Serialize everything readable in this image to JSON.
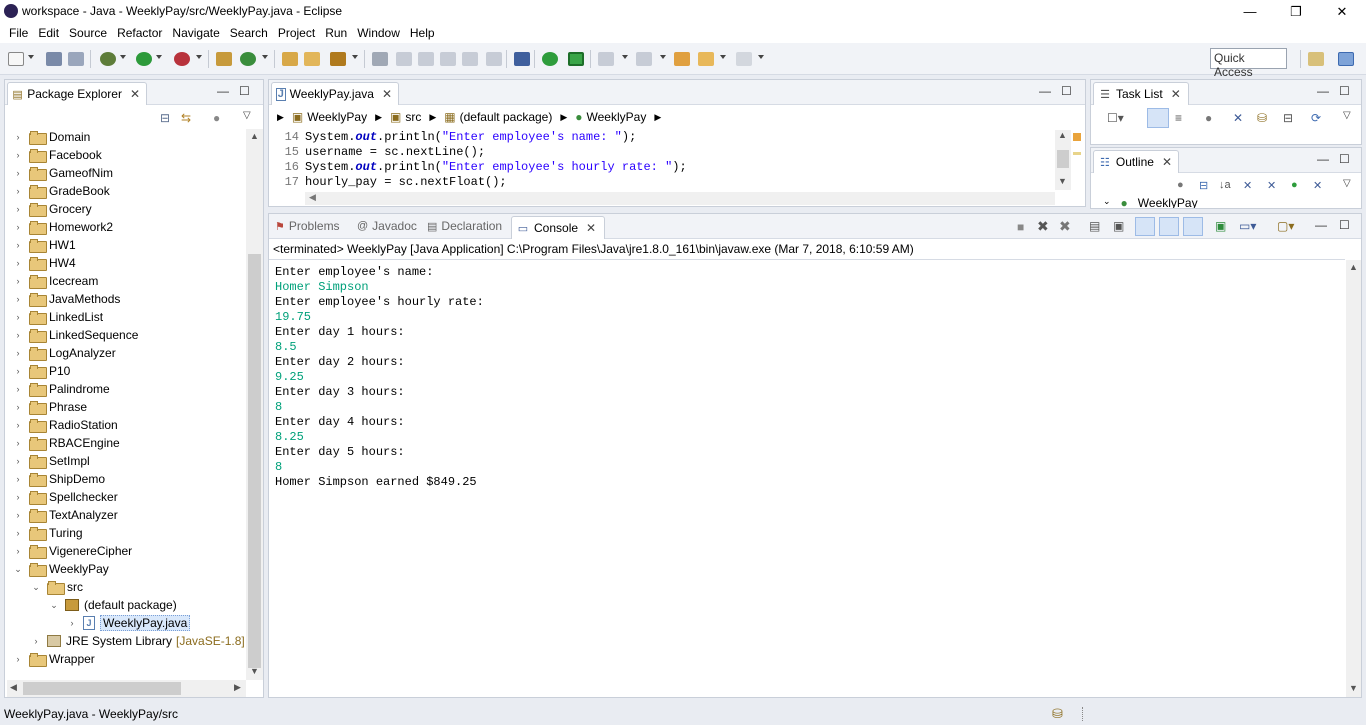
{
  "window": {
    "title": "workspace - Java - WeeklyPay/src/WeeklyPay.java - Eclipse",
    "minimize": "—",
    "restore": "❐",
    "close": "✕"
  },
  "menu": [
    "File",
    "Edit",
    "Source",
    "Refactor",
    "Navigate",
    "Search",
    "Project",
    "Run",
    "Window",
    "Help"
  ],
  "toolbar": {
    "quick_access": "Quick Access"
  },
  "package_explorer": {
    "tab_label": "Package Explorer",
    "projects": [
      "Domain",
      "Facebook",
      "GameofNim",
      "GradeBook",
      "Grocery",
      "Homework2",
      "HW1",
      "HW4",
      "Icecream",
      "JavaMethods",
      "LinkedList",
      "LinkedSequence",
      "LogAnalyzer",
      "P10",
      "Palindrome",
      "Phrase",
      "RadioStation",
      "RBACEngine",
      "SetImpl",
      "ShipDemo",
      "Spellchecker",
      "TextAnalyzer",
      "Turing",
      "VigenereCipher",
      "WeeklyPay"
    ],
    "expanded": {
      "src": "src",
      "default_package": "(default package)",
      "file": "WeeklyPay.java",
      "jre": "JRE System Library",
      "jre_version": "[JavaSE-1.8]",
      "last_project": "Wrapper"
    }
  },
  "editor": {
    "tab_label": "WeeklyPay.java",
    "breadcrumb": [
      "WeeklyPay",
      "src",
      "(default package)",
      "WeeklyPay"
    ],
    "lines": [
      {
        "num": "14",
        "pre": "System.",
        "field": "out",
        "mid": ".println(",
        "str": "\"Enter employee's name: \"",
        "post": ");"
      },
      {
        "num": "15",
        "pre": "username = sc.nextLine();",
        "field": "",
        "mid": "",
        "str": "",
        "post": ""
      },
      {
        "num": "16",
        "pre": "System.",
        "field": "out",
        "mid": ".println(",
        "str": "\"Enter employee's hourly rate: \"",
        "post": ");"
      },
      {
        "num": "17",
        "pre": "hourly_pay = sc.nextFloat();",
        "field": "",
        "mid": "",
        "str": "",
        "post": ""
      }
    ]
  },
  "task_list": {
    "tab_label": "Task List"
  },
  "outline": {
    "tab_label": "Outline",
    "item": "WeeklyPay"
  },
  "console_view": {
    "tabs": {
      "problems": "Problems",
      "javadoc": "Javadoc",
      "declaration": "Declaration",
      "console": "Console"
    },
    "status": "<terminated> WeeklyPay [Java Application] C:\\Program Files\\Java\\jre1.8.0_161\\bin\\javaw.exe (Mar 7, 2018, 6:10:59 AM)",
    "output": [
      {
        "text": "Enter employee's name:",
        "input": false
      },
      {
        "text": "Homer Simpson",
        "input": true
      },
      {
        "text": "Enter employee's hourly rate:",
        "input": false
      },
      {
        "text": "19.75",
        "input": true
      },
      {
        "text": "Enter day 1 hours:",
        "input": false
      },
      {
        "text": "8.5",
        "input": true
      },
      {
        "text": "Enter day 2 hours:",
        "input": false
      },
      {
        "text": "9.25",
        "input": true
      },
      {
        "text": "Enter day 3 hours:",
        "input": false
      },
      {
        "text": "8",
        "input": true
      },
      {
        "text": "Enter day 4 hours:",
        "input": false
      },
      {
        "text": "8.25",
        "input": true
      },
      {
        "text": "Enter day 5 hours:",
        "input": false
      },
      {
        "text": "8",
        "input": true
      },
      {
        "text": "Homer Simpson earned $849.25",
        "input": false
      }
    ]
  },
  "statusbar": {
    "text": "WeeklyPay.java - WeeklyPay/src"
  },
  "colors": {
    "console_input": "#00a07a",
    "keyword": "#7f0055",
    "string": "#2a00ff"
  }
}
